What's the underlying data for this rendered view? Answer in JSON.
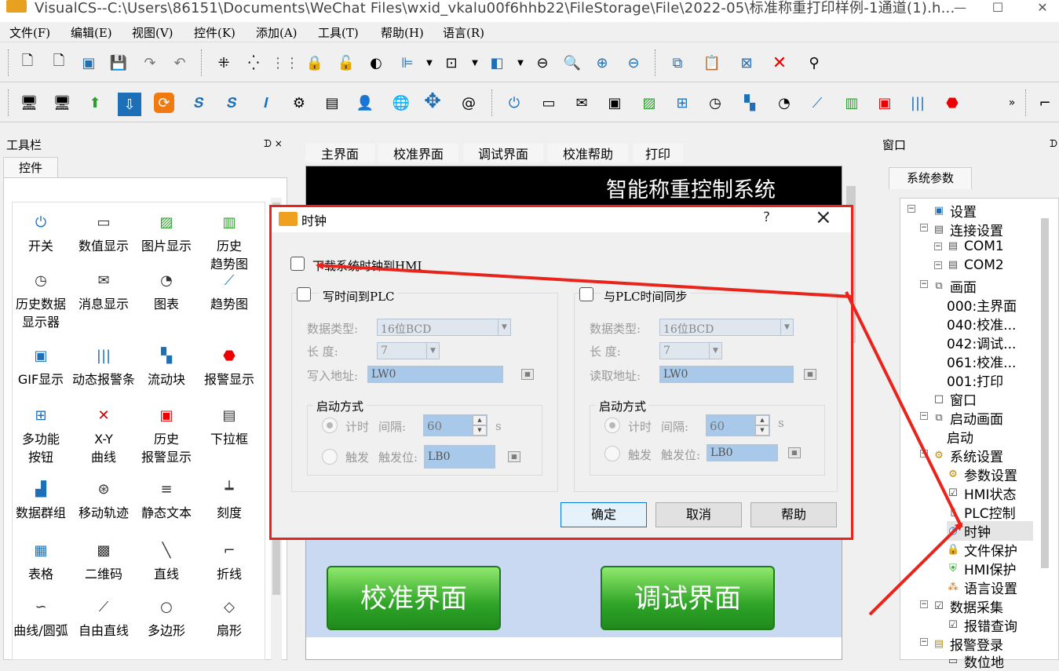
{
  "window": {
    "title": "VisualCS--C:\\Users\\86151\\Documents\\WeChat Files\\wxid_vkalu00f6hhb22\\FileStorage\\File\\2022-05\\标准称重打印样例-1通道(1).h..."
  },
  "menu": [
    "文件(F)",
    "编辑(E)",
    "视图(V)",
    "控件(K)",
    "添加(A)",
    "工具(T)",
    "帮助(H)",
    "语言(R)"
  ],
  "left_panel": {
    "title": "工具栏",
    "pin": "ᗪ ×",
    "tab": "控件",
    "controls": [
      {
        "label": "开关",
        "icon": "power-icon"
      },
      {
        "label": "数值显示",
        "icon": "numeric-icon"
      },
      {
        "label": "图片显示",
        "icon": "picture-icon"
      },
      {
        "label": "历史\n趋势图",
        "icon": "history-trend-icon"
      },
      {
        "label": "历史数据\n显示器",
        "icon": "history-data-icon"
      },
      {
        "label": "消息显示",
        "icon": "message-icon"
      },
      {
        "label": "图表",
        "icon": "meter-icon"
      },
      {
        "label": "趋势图",
        "icon": "trend-icon"
      },
      {
        "label": "GIF显示",
        "icon": "gif-icon"
      },
      {
        "label": "动态报警条",
        "icon": "alarm-bar-icon"
      },
      {
        "label": "流动块",
        "icon": "flow-block-icon"
      },
      {
        "label": "报警显示",
        "icon": "alarm-icon"
      },
      {
        "label": "多功能\n按钮",
        "icon": "multifunction-icon"
      },
      {
        "label": "X-Y\n曲线",
        "icon": "xy-curve-icon"
      },
      {
        "label": "历史\n报警显示",
        "icon": "history-alarm-icon"
      },
      {
        "label": "下拉框",
        "icon": "dropdown-icon"
      },
      {
        "label": "数据群组",
        "icon": "data-group-icon"
      },
      {
        "label": "移动轨迹",
        "icon": "move-track-icon"
      },
      {
        "label": "静态文本",
        "icon": "static-text-icon"
      },
      {
        "label": "刻度",
        "icon": "scale-icon"
      },
      {
        "label": "表格",
        "icon": "table-icon"
      },
      {
        "label": "二维码",
        "icon": "qrcode-icon"
      },
      {
        "label": "直线",
        "icon": "line-icon"
      },
      {
        "label": "折线",
        "icon": "polyline-icon"
      },
      {
        "label": "曲线/圆弧",
        "icon": "curve-icon"
      },
      {
        "label": "自由直线",
        "icon": "free-line-icon"
      },
      {
        "label": "多边形",
        "icon": "polygon-icon"
      },
      {
        "label": "扇形",
        "icon": "sector-icon"
      }
    ]
  },
  "center": {
    "tabs": [
      "主界面",
      "校准界面",
      "调试界面",
      "校准帮助",
      "打印"
    ],
    "screen_title": "智能称重控制系统",
    "btn_calibrate": "校准界面",
    "btn_debug": "调试界面"
  },
  "right_panel": {
    "title": "窗口",
    "tab": "系统参数",
    "tree": {
      "settings": "设置",
      "connection": "连接设置",
      "com1": "COM1",
      "com2": "COM2",
      "screens": "画面",
      "s000": "000:主界面",
      "s040": "040:校准...",
      "s042": "042:调试...",
      "s061": "061:校准...",
      "s001": "001:打印",
      "window": "窗口",
      "startup_screen": "启动画面",
      "startup": "启动",
      "system_settings": "系统设置",
      "params": "参数设置",
      "hmi_status": "HMI状态",
      "plc_control": "PLC控制",
      "clock": "时钟",
      "file_protect": "文件保护",
      "hmi_protect": "HMI保护",
      "language": "语言设置",
      "data_collect": "数据采集",
      "error_query": "报错查询",
      "alarm_login": "报警登录",
      "digital": "数位地"
    }
  },
  "dialog": {
    "title": "时钟",
    "help_q": "?",
    "close": "×",
    "download_clock": "下载系统时钟到HMI",
    "left_group": {
      "title": "写时间到PLC",
      "data_type_label": "数据类型:",
      "data_type_value": "16位BCD",
      "length_label": "长    度:",
      "length_value": "7",
      "address_label": "写入地址:",
      "address_value": "LW0",
      "start_mode": "启动方式",
      "timer": "计时",
      "interval_label": "间隔:",
      "interval_value": "60",
      "unit": "s",
      "trigger": "触发",
      "trigger_bit_label": "触发位:",
      "trigger_bit_value": "LB0"
    },
    "right_group": {
      "title": "与PLC时间同步",
      "data_type_label": "数据类型:",
      "data_type_value": "16位BCD",
      "length_label": "长    度:",
      "length_value": "7",
      "address_label": "读取地址:",
      "address_value": "LW0",
      "start_mode": "启动方式",
      "timer": "计时",
      "interval_label": "间隔:",
      "interval_value": "60",
      "unit": "s",
      "trigger": "触发",
      "trigger_bit_label": "触发位:",
      "trigger_bit_value": "LB0"
    },
    "ok": "确定",
    "cancel": "取消",
    "help": "帮助"
  },
  "annotation_color": "#e8241d",
  "more_tools": "»"
}
